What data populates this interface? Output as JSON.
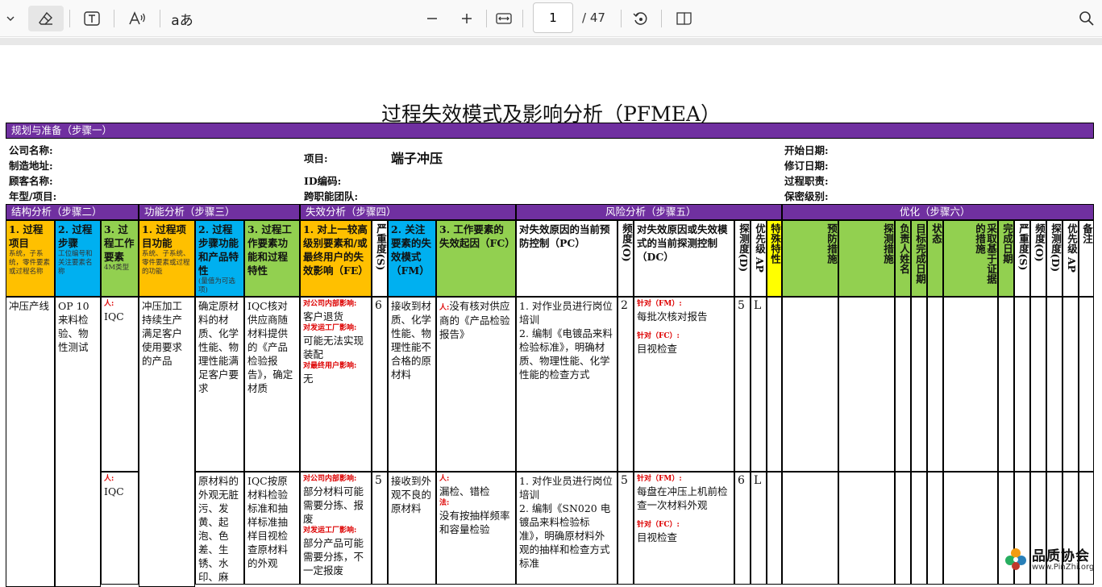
{
  "toolbar": {
    "page_current": "1",
    "page_total": "/ 47",
    "text_icon_label": "T",
    "aa_label": "aあ",
    "read_label": "A"
  },
  "document": {
    "title": "过程失效模式及影响分析（PFMEA）",
    "step1": "规划与准备（步骤一）",
    "labels": {
      "company": "公司名称:",
      "mfg": "制造地址:",
      "customer": "顾客名称:",
      "model": "年型/项目:",
      "project": "项目:",
      "project_value": "端子冲压",
      "id": "ID编码:",
      "team": "跨职能团队:",
      "start": "开始日期:",
      "rev": "修订日期:",
      "role": "过程职责:",
      "secret": "保密级别:"
    },
    "sections": {
      "structure": "结构分析（步骤二）",
      "function": "功能分析（步骤三）",
      "failure": "失效分析（步骤四）",
      "risk": "风险分析（步骤五）",
      "optimize": "优化（步骤六）"
    },
    "headers": {
      "h1": "1. 过程项目",
      "h1s": "系统，子系统，零件要素或过程名称",
      "h2": "2. 过程步骤",
      "h2s": "工位编号和关注要素名称",
      "h3": "3. 过程工作要素",
      "h3s": "4M类型",
      "h4": "1. 过程项目功能",
      "h4s": "系统、子系统、零件要素或过程的功能",
      "h5": "2. 过程步骤功能和产品特性",
      "h5s": "(量值为可选项)",
      "h6": "3. 过程工作要素功能和过程特性",
      "h7": "1. 对上一较高级别要素和/或最终用户的失效影响（FE）",
      "h8": "严重度(S)",
      "h9": "2. 关注要素的失效模式（FM）",
      "h10": "3. 工作要素的失效起因（FC）",
      "h11": "对失效原因的当前预防控制（PC）",
      "h12": "频度(O)",
      "h13": "对失效原因或失效模式的当前探测控制（DC）",
      "h14": "探测度(D)",
      "h15": "优先级 AP",
      "h16": "特殊特性",
      "h17": "预防措施",
      "h18": "探测措施",
      "h19": "负责人姓名",
      "h20": "目标完成日期",
      "h21": "状态",
      "h22": "采取基于证据的措施",
      "h23": "完成日期",
      "h24": "严重度(S)",
      "h25": "频度(O)",
      "h26": "探测度(D)",
      "h27": "优先级 AP",
      "h28": "备注"
    },
    "row1": {
      "item": "冲压产线",
      "step": "OP 10 来料检验、物性测试",
      "elem_tag": "人:",
      "elem": "IQC",
      "func1": "冲压加工持续生产满足客户使用要求的产品",
      "func2": "确定原材料的材质、化学性能、物理性能满足客户要求",
      "func3": "IQC核对供应商随材料提供的《产品检验报告》，确定材质",
      "fe_t1": "对公司内部影响:",
      "fe_1": "客户退货",
      "fe_t2": "对发运工厂影响:",
      "fe_2": "可能无法实现装配",
      "fe_t3": "对最终用户影响:",
      "fe_3": "无",
      "s": "6",
      "fm": "接收到材质、化学性能、物理性能不合格的原材料",
      "fc_tag": "人:",
      "fc": "没有核对供应商的《产品检验报告》",
      "pc": "1. 对作业员进行岗位培训\n2. 编制《电镀品来料检验标准》，明确材质、物理性能、化学性能的检查方式",
      "o": "2",
      "dc_t1": "针对（FM）:",
      "dc_1": "每批次核对报告",
      "dc_t2": "针对（FC）:",
      "dc_2": "目视检查",
      "d": "5",
      "ap": "L"
    },
    "row2": {
      "elem_tag": "人:",
      "elem": "IQC",
      "func2": "原材料的外观无脏污、发黄、起泡、色差、生锈、水印、麻点、刮伤凹凸",
      "func3": "IQC按原材料检验标准和抽样标准抽样目视检查原材料的外观",
      "fe_t1": "对公司内部影响:",
      "fe_1": "部分材料可能需要分拣、报废",
      "fe_t2": "对发运工厂影响:",
      "fe_2": "部分产品可能需要分拣，不一定报废",
      "s": "5",
      "fm": "接收到外观不良的原材料",
      "fc_tag1": "人:",
      "fc_1": "漏检、错检",
      "fc_tag2": "法:",
      "fc_2": "没有按抽样频率和容量检验",
      "pc": "1. 对作业员进行岗位培训\n2. 编制《SN020 电镀品来料检验标准》，明确原材料外观的抽样和检查方式标准",
      "o": "5",
      "dc_t1": "针对（FM）:",
      "dc_1": "每盘在冲压上机前检查一次材料外观",
      "dc_t2": "针对（FC）:",
      "dc_2": "目视检查",
      "d": "6",
      "ap": "L"
    }
  },
  "watermark": {
    "name": "品质协会",
    "url": "www.PinZhi.org"
  }
}
